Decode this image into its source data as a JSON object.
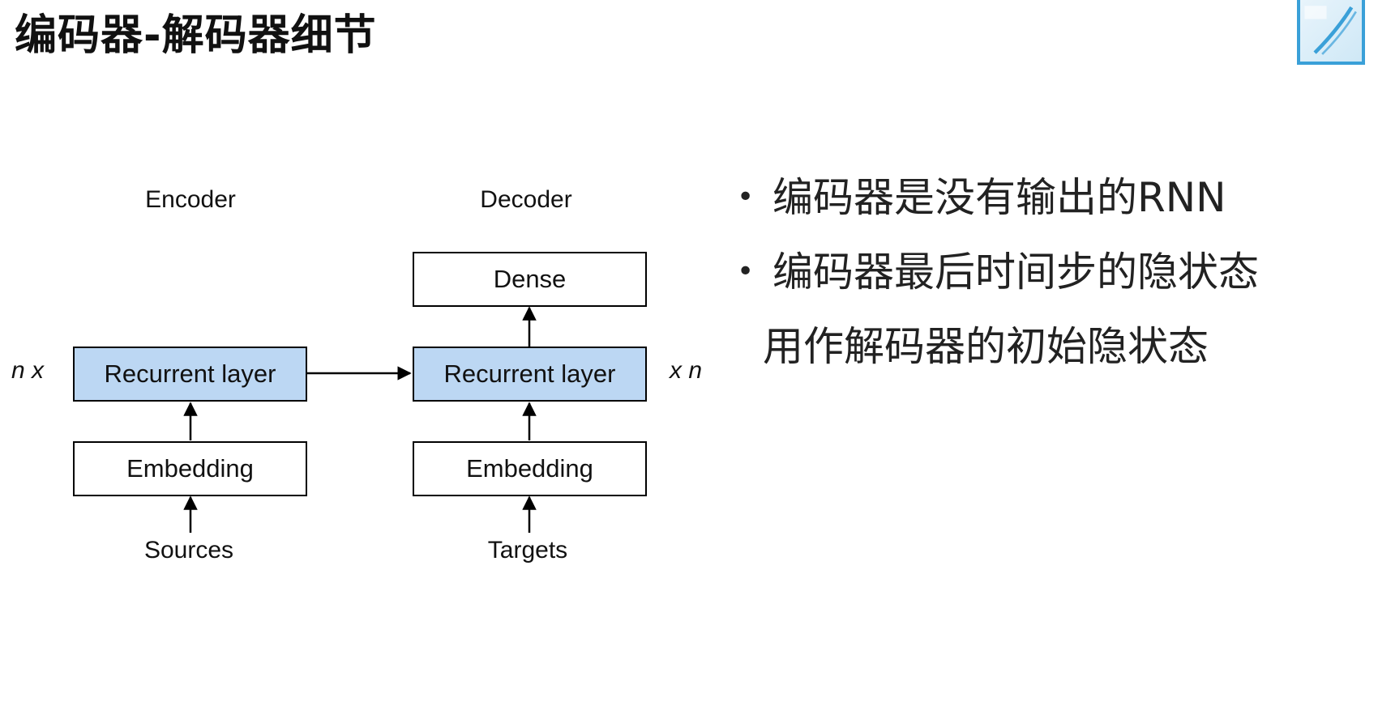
{
  "title": "编码器-解码器细节",
  "logo": {
    "icon": "bilibili-style-logo-icon",
    "accent": "#3aa0d8"
  },
  "diagram": {
    "encoder_label": "Encoder",
    "decoder_label": "Decoder",
    "encoder_repeat": "n x",
    "decoder_repeat": "x n",
    "encoder": {
      "recurrent": "Recurrent layer",
      "embedding": "Embedding",
      "input": "Sources"
    },
    "decoder": {
      "dense": "Dense",
      "recurrent": "Recurrent layer",
      "embedding": "Embedding",
      "input": "Targets"
    },
    "colors": {
      "recurrent_fill": "#bcd7f3",
      "box_border": "#000000"
    }
  },
  "bullets": [
    {
      "text": "编码器是没有输出的RNN"
    },
    {
      "line1": "编码器最后时间步的隐状态",
      "line2": "用作解码器的初始隐状态"
    }
  ]
}
